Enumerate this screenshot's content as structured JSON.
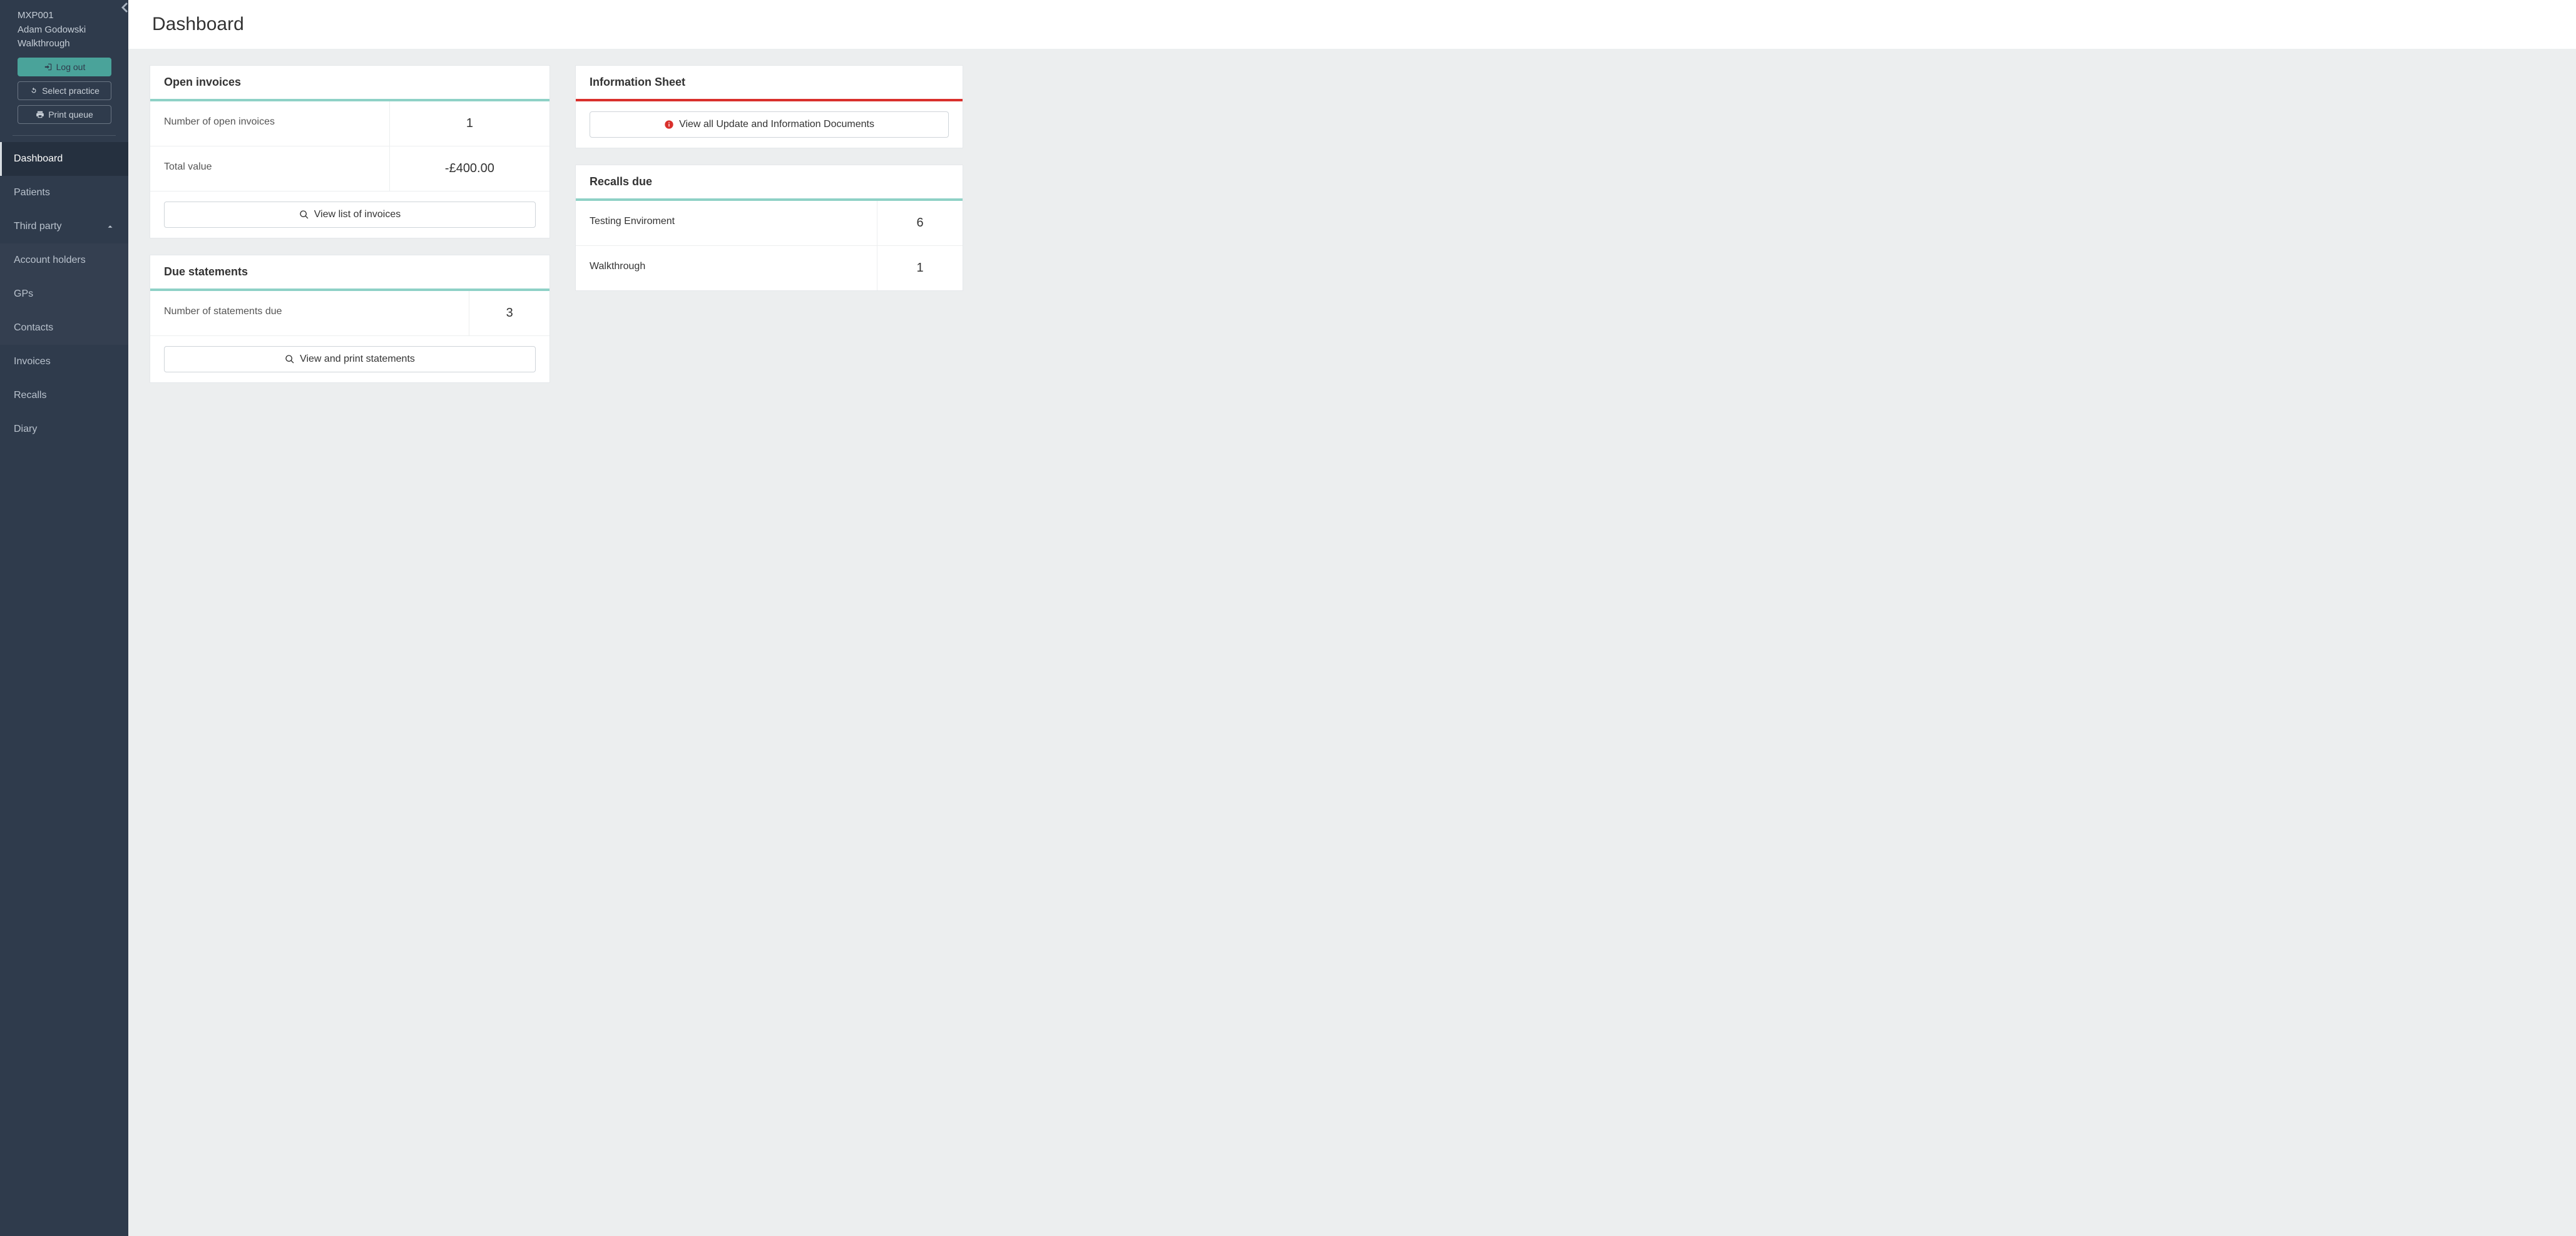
{
  "sidebar": {
    "user_code": "MXP001",
    "user_name": "Adam Godowski",
    "user_context": "Walkthrough",
    "logout_label": "Log out",
    "select_practice_label": "Select practice",
    "print_queue_label": "Print queue",
    "nav": {
      "dashboard": "Dashboard",
      "patients": "Patients",
      "third_party": "Third party",
      "account_holders": "Account holders",
      "gps": "GPs",
      "contacts": "Contacts",
      "invoices": "Invoices",
      "recalls": "Recalls",
      "diary": "Diary"
    }
  },
  "page": {
    "title": "Dashboard"
  },
  "open_invoices": {
    "title": "Open invoices",
    "count_label": "Number of open invoices",
    "count_value": "1",
    "total_label": "Total value",
    "total_value": "-£400.00",
    "action_label": "View list of invoices"
  },
  "due_statements": {
    "title": "Due statements",
    "count_label": "Number of statements due",
    "count_value": "3",
    "action_label": "View and print statements"
  },
  "info_sheet": {
    "title": "Information Sheet",
    "action_label": "View all Update and Information Documents"
  },
  "recalls_due": {
    "title": "Recalls due",
    "rows": [
      {
        "label": "Testing Enviroment",
        "value": "6"
      },
      {
        "label": "Walkthrough",
        "value": "1"
      }
    ]
  }
}
